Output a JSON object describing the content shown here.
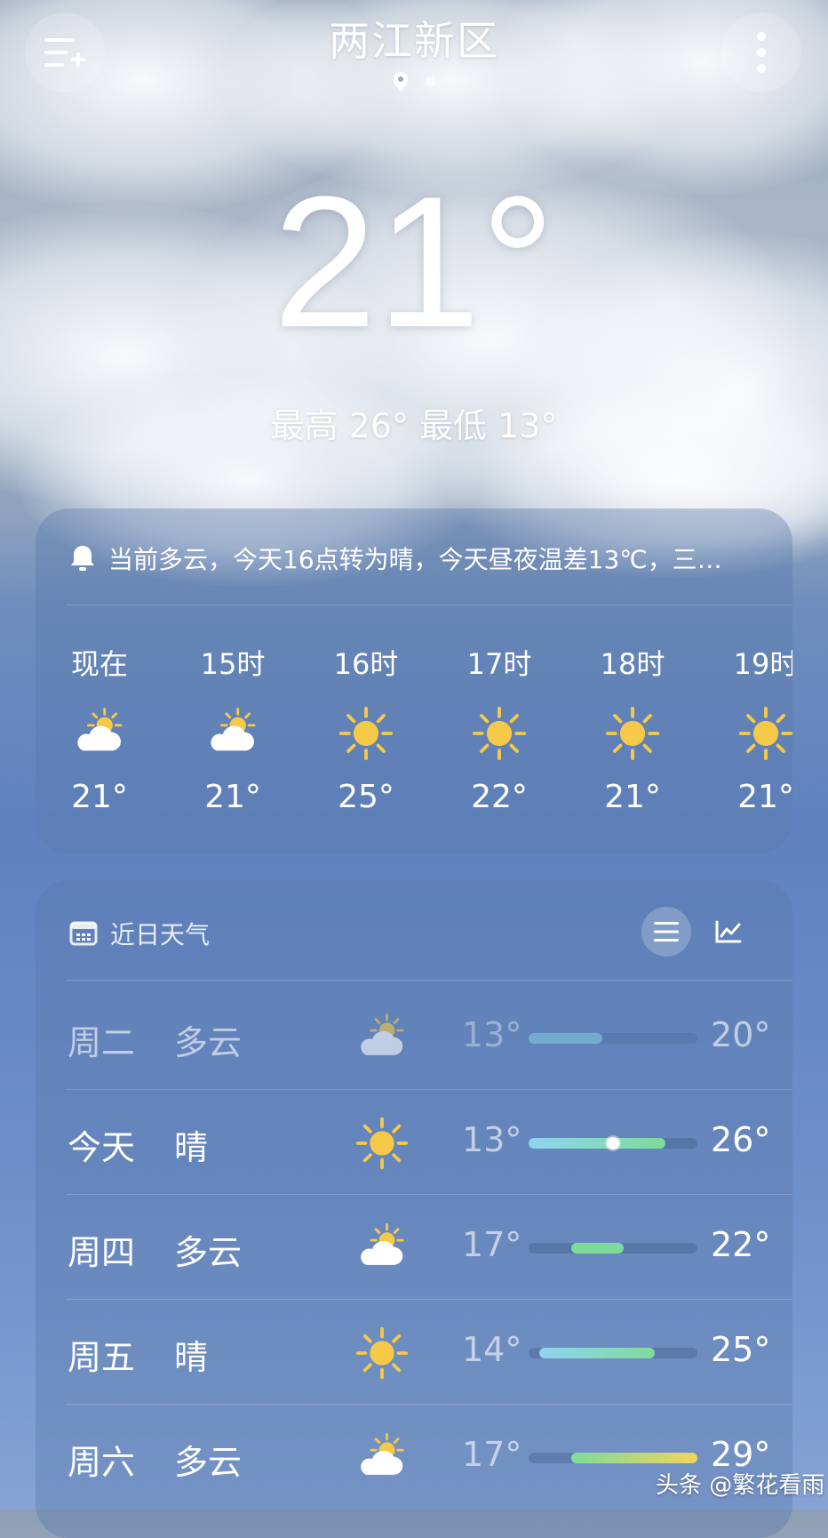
{
  "location": {
    "city": "两江新区"
  },
  "current": {
    "temperature": "21°",
    "high_low": "最高 26° 最低 13°"
  },
  "alert": {
    "text": "当前多云，今天16点转为晴，今天昼夜温差13℃，三…"
  },
  "hourly": [
    {
      "time": "现在",
      "icon": "partly-cloudy-icon",
      "temp": "21°"
    },
    {
      "time": "15时",
      "icon": "partly-cloudy-icon",
      "temp": "21°"
    },
    {
      "time": "16时",
      "icon": "sunny-icon",
      "temp": "25°"
    },
    {
      "time": "17时",
      "icon": "sunny-icon",
      "temp": "22°"
    },
    {
      "time": "18时",
      "icon": "sunny-icon",
      "temp": "21°"
    },
    {
      "time": "19时",
      "icon": "sunny-icon",
      "temp": "21°"
    }
  ],
  "forecast": {
    "title": "近日天气",
    "range_min": 13,
    "range_max": 29,
    "days": [
      {
        "day": "周二",
        "condition": "多云",
        "icon": "partly-cloudy-icon",
        "low": "13°",
        "high": "20°",
        "low_val": 13,
        "high_val": 20,
        "past": true
      },
      {
        "day": "今天",
        "condition": "晴",
        "icon": "sunny-icon",
        "low": "13°",
        "high": "26°",
        "low_val": 13,
        "high_val": 26,
        "current_val": 21,
        "past": false
      },
      {
        "day": "周四",
        "condition": "多云",
        "icon": "partly-cloudy-icon",
        "low": "17°",
        "high": "22°",
        "low_val": 17,
        "high_val": 22,
        "past": false
      },
      {
        "day": "周五",
        "condition": "晴",
        "icon": "sunny-icon",
        "low": "14°",
        "high": "25°",
        "low_val": 14,
        "high_val": 25,
        "past": false
      },
      {
        "day": "周六",
        "condition": "多云",
        "icon": "partly-cloudy-icon",
        "low": "17°",
        "high": "29°",
        "low_val": 17,
        "high_val": 29,
        "past": false
      }
    ]
  },
  "watermark": "头条 @繁花看雨",
  "colors": {
    "sun": "#f7c948",
    "bar_cool": "#8fd3f2",
    "bar_mild": "#7ddc9a",
    "bar_warm": "#f2d45c",
    "past_bar": "#7ec8d8"
  }
}
